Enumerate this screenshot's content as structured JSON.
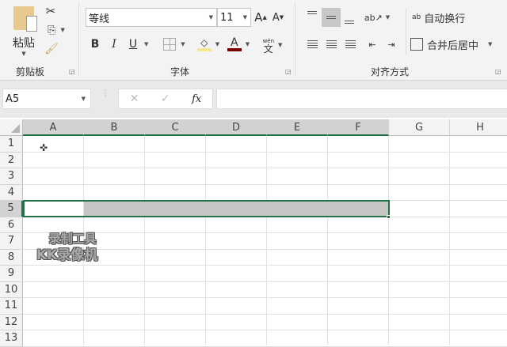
{
  "clipboard": {
    "paste_label": "粘贴",
    "group_label": "剪贴板"
  },
  "font": {
    "font_name": "等线",
    "font_size": "11",
    "group_label": "字体",
    "bold": "B",
    "italic": "I",
    "underline": "U",
    "phonetic_top": "wén",
    "phonetic_bottom": "文"
  },
  "alignment": {
    "wrap_text_label": "自动换行",
    "merge_center_label": "合并后居中",
    "group_label": "对齐方式",
    "wrap_icon_text": "ab"
  },
  "formula_bar": {
    "name_box": "A5",
    "fx": "fx",
    "cancel": "✕",
    "enter": "✓",
    "formula_value": ""
  },
  "sheet": {
    "columns": [
      "A",
      "B",
      "C",
      "D",
      "E",
      "F",
      "G",
      "H"
    ],
    "rows": [
      "1",
      "2",
      "3",
      "4",
      "5",
      "6",
      "7",
      "8",
      "9",
      "10",
      "11",
      "12",
      "13"
    ],
    "active_cell": "A5",
    "selection": "A5:F5"
  },
  "watermark": {
    "line1": "录制工具",
    "line2": "KK录像机"
  },
  "colors": {
    "accent": "#217346",
    "selection_fill": "#c6c6c6",
    "font_color": "#7a0000",
    "highlight": "#f7e98e"
  }
}
